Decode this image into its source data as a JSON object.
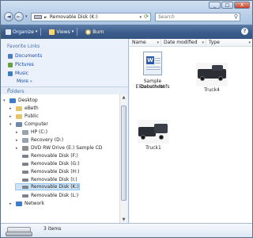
{
  "titlebar": {
    "buttons": [
      "_",
      "□",
      "X"
    ]
  },
  "nav": {
    "back_glyph": "◄",
    "forward_glyph": "►",
    "dropdown_glyph": "▾"
  },
  "address": {
    "separator": "►",
    "path": "Removable Disk (K:)",
    "dropdown_glyph": "▾",
    "refresh_glyph": "⟳"
  },
  "search": {
    "placeholder": "Search"
  },
  "toolbar": {
    "organize": "Organize",
    "views": "Views",
    "burn": "Burn",
    "dropdown_glyph": "▾",
    "help_glyph": "?"
  },
  "navpane": {
    "favorites_title": "Favorite Links",
    "favorites": [
      {
        "label": "Documents",
        "icon": "documents-icon",
        "color": "#4f7cc0"
      },
      {
        "label": "Pictures",
        "icon": "pictures-icon",
        "color": "#6a9f3d"
      },
      {
        "label": "Music",
        "icon": "music-icon",
        "color": "#3d7fc0"
      }
    ],
    "more_label": "More",
    "more_glyph": "»",
    "folders_title": "Folders",
    "folders_caret": "^"
  },
  "tree": {
    "items": [
      {
        "label": "Desktop",
        "icon": "desktop-icon",
        "color": "#3e7cc7",
        "indent": 0,
        "toggle": "▾"
      },
      {
        "label": "eBeth",
        "icon": "user-folder-icon",
        "color": "#e3c56b",
        "indent": 1,
        "toggle": "▸"
      },
      {
        "label": "Public",
        "icon": "public-folder-icon",
        "color": "#e3c56b",
        "indent": 1,
        "toggle": "▸"
      },
      {
        "label": "Computer",
        "icon": "computer-icon",
        "color": "#6f86a6",
        "indent": 1,
        "toggle": "▾"
      },
      {
        "label": "HP (C:)",
        "icon": "hard-disk-icon",
        "color": "#9aa3ad",
        "indent": 2,
        "toggle": "▸"
      },
      {
        "label": "Recovery (D:)",
        "icon": "hard-disk-icon",
        "color": "#9aa3ad",
        "indent": 2,
        "toggle": "▸"
      },
      {
        "label": "DVD RW Drive (E:) Sample CD",
        "icon": "dvd-drive-icon",
        "color": "#8d8d8d",
        "indent": 2,
        "toggle": "▸"
      },
      {
        "label": "Removable Disk (F:)",
        "icon": "removable-disk-icon",
        "color": "#7d838c",
        "indent": 2,
        "toggle": ""
      },
      {
        "label": "Removable Disk (G:)",
        "icon": "removable-disk-icon",
        "color": "#7d838c",
        "indent": 2,
        "toggle": ""
      },
      {
        "label": "Removable Disk (H:)",
        "icon": "removable-disk-icon",
        "color": "#7d838c",
        "indent": 2,
        "toggle": ""
      },
      {
        "label": "Removable Disk (I:)",
        "icon": "removable-disk-icon",
        "color": "#7d838c",
        "indent": 2,
        "toggle": ""
      },
      {
        "label": "Removable Disk (K:)",
        "icon": "removable-disk-icon",
        "color": "#7d838c",
        "indent": 2,
        "toggle": "",
        "selected": true
      },
      {
        "label": "Removable Disk (L:)",
        "icon": "removable-disk-icon",
        "color": "#7d838c",
        "indent": 2,
        "toggle": ""
      },
      {
        "label": "Network",
        "icon": "network-icon",
        "color": "#3e7cc7",
        "indent": 1,
        "toggle": "▸"
      }
    ],
    "scroll_up": "▲",
    "scroll_down": "▼"
  },
  "content": {
    "columns": [
      "Name",
      "Date modified",
      "Type"
    ],
    "column_arrow": "▾",
    "sort_glyph": "^",
    "files": [
      {
        "name_line1": "Sample Document",
        "name_line2": "Elizabeth Nofs",
        "icon": "word-document-icon",
        "glyph": "W"
      },
      {
        "name_line1": "Truck4",
        "name_line2": "",
        "icon": "truck-photo-icon"
      },
      {
        "name_line1": "Truck1",
        "name_line2": "",
        "icon": "truck-photo-icon"
      }
    ]
  },
  "status": {
    "count": "3 items"
  },
  "colors": {
    "toolbar": "#3c5d8c",
    "selection": "#cde4f7",
    "link": "#1a49a8"
  }
}
